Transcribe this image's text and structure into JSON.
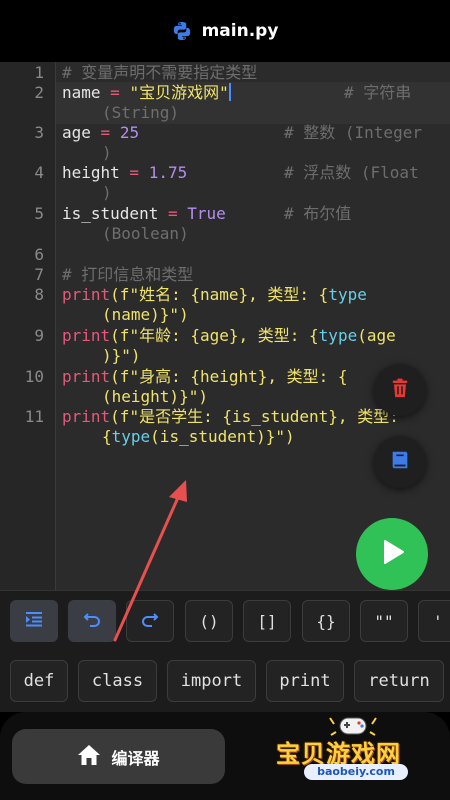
{
  "header": {
    "title": "main.py",
    "icon": "python-logo-icon"
  },
  "editor": {
    "lines": [
      {
        "n": "1",
        "text": "# 变量声明不需要指定类型"
      },
      {
        "n": "2",
        "name": "name",
        "op": " = ",
        "value": "\"宝贝游戏网\"",
        "comment": "# 字符串",
        "cont": "(String)"
      },
      {
        "n": "3",
        "name": "age",
        "op": " = ",
        "value": "25",
        "comment": "# 整数 (Integer",
        "cont": ")"
      },
      {
        "n": "4",
        "name": "height",
        "op": " = ",
        "value": "1.75",
        "comment": "# 浮点数 (Float",
        "cont": ")"
      },
      {
        "n": "5",
        "name": "is_student",
        "op": " = ",
        "value": "True",
        "comment": "# 布尔值",
        "cont": "(Boolean)"
      },
      {
        "n": "6"
      },
      {
        "n": "7",
        "text": "# 打印信息和类型"
      },
      {
        "n": "8",
        "fn": "print",
        "a": "(f\"姓名: {name}, 类型: {",
        "b": "type",
        "cont": "(name)}\")"
      },
      {
        "n": "9",
        "fn": "print",
        "a": "(f\"年龄: {age}, 类型: {",
        "b": "type",
        "c": "(age",
        "cont": ")}\")"
      },
      {
        "n": "10",
        "fn": "print",
        "a": "(f\"身高: {height}, 类型: {",
        "cont": "(height)}\")"
      },
      {
        "n": "11",
        "fn": "print",
        "a": "(f\"是否学生: {is_student}, 类型:",
        "cont_pre": "{",
        "cont_b": "type",
        "cont": "(is_student)}\")"
      }
    ]
  },
  "fabs": {
    "delete": "trash-icon",
    "book": "book-icon",
    "run": "play-icon"
  },
  "toolbar1": {
    "indent": "indent-icon",
    "undo": "undo-icon",
    "redo": "redo-icon",
    "parens": "()",
    "brackets": "[]",
    "braces": "{}",
    "dquotes": "\"\"",
    "squote": "'"
  },
  "toolbar2": {
    "keywords": [
      "def",
      "class",
      "import",
      "print",
      "return"
    ]
  },
  "bottom": {
    "compiler_label": "编译器",
    "home_icon": "home-icon"
  },
  "watermark": {
    "name": "宝贝游戏网",
    "url": "baobeiy.com"
  },
  "colors": {
    "keyword": "#e9577b",
    "string": "#f0e36a",
    "number": "#b48ef0",
    "builtin": "#67d0e8",
    "comment": "#6d6d6d",
    "run": "#30c257",
    "delete": "#e53935",
    "book": "#3d7be8",
    "arrow": "#e85050"
  }
}
